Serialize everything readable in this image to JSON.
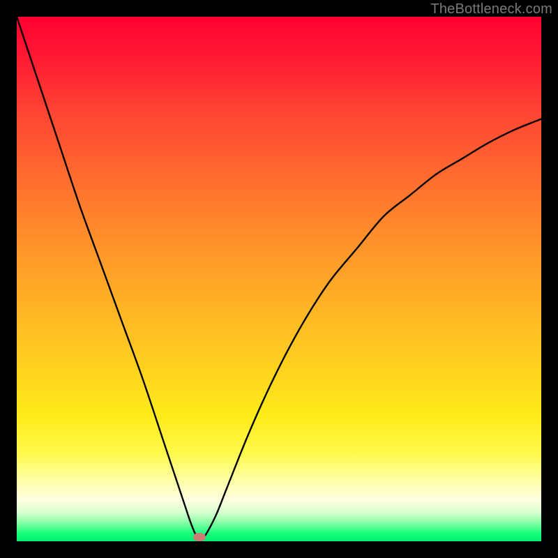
{
  "watermark": "TheBottleneck.com",
  "chart_data": {
    "type": "line",
    "title": "",
    "xlabel": "",
    "ylabel": "",
    "xlim": [
      0,
      100
    ],
    "ylim": [
      0,
      100
    ],
    "grid": false,
    "legend": false,
    "background": "vertical-gradient-red-to-green",
    "curve_color": "#000000",
    "series": [
      {
        "name": "bottleneck-curve",
        "x": [
          0,
          4,
          8,
          12,
          16,
          20,
          24,
          28,
          30,
          32,
          33,
          34,
          35,
          36,
          38,
          40,
          44,
          48,
          52,
          56,
          60,
          65,
          70,
          75,
          80,
          85,
          90,
          95,
          100
        ],
        "y": [
          100,
          88,
          76,
          64,
          53,
          42,
          31,
          19,
          13,
          7,
          4,
          1.5,
          0.2,
          1.2,
          5,
          10,
          20,
          29,
          37,
          44,
          50,
          56,
          62,
          66,
          70,
          73,
          76,
          78.5,
          80.5
        ]
      }
    ],
    "marker": {
      "x": 34.8,
      "shape": "pill",
      "color": "#c97e76"
    },
    "bottleneck_position_percent": 34.8
  },
  "frame": {
    "inner_left": 24,
    "inner_top": 24,
    "inner_size": 752
  }
}
